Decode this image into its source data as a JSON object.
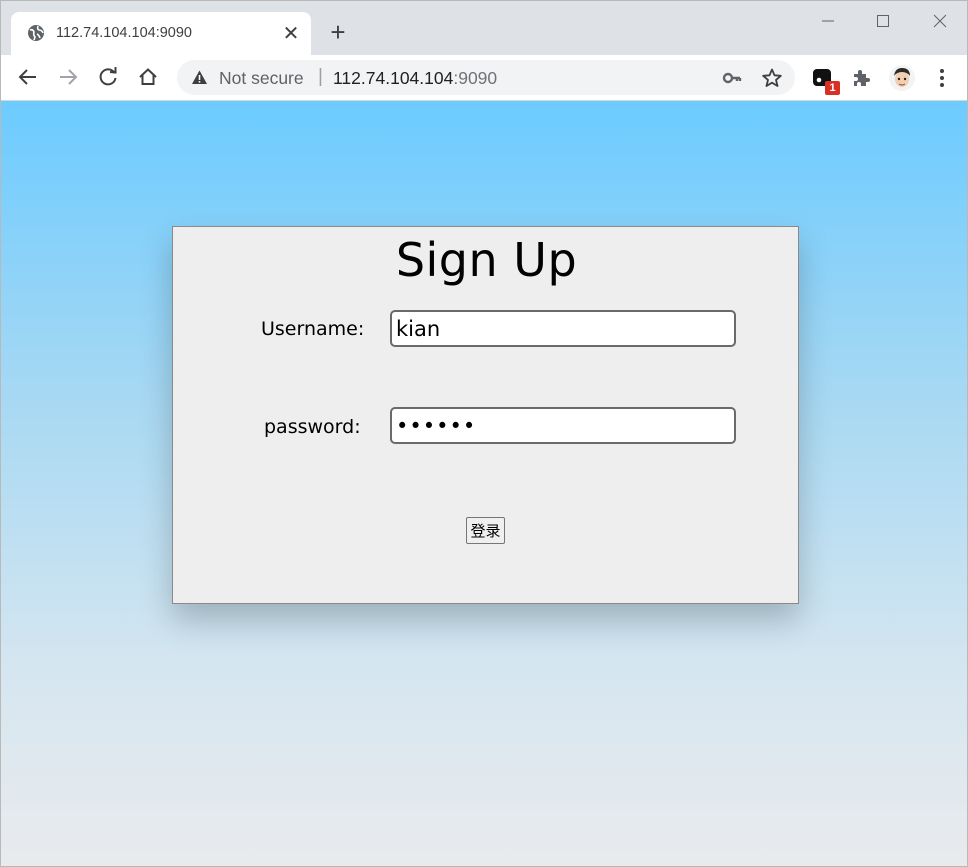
{
  "browser": {
    "tab_title": "112.74.104.104:9090",
    "new_tab_symbol": "+",
    "tab_close_symbol": "✕",
    "address": {
      "security_label": "Not secure",
      "separator": "|",
      "host": "112.74.104.104",
      "port": ":9090"
    },
    "extension_badge": "1",
    "icons": [
      "globe-icon",
      "close-icon",
      "plus-icon",
      "minimize-icon",
      "maximize-icon",
      "window-close-icon",
      "back-icon",
      "forward-icon",
      "reload-icon",
      "home-icon",
      "warning-icon",
      "key-icon",
      "star-icon",
      "extension-icon",
      "puzzle-icon",
      "avatar",
      "menu-dots-icon"
    ]
  },
  "form": {
    "title": "Sign Up",
    "username_label": "Username:",
    "username_value": "kian",
    "password_label": "password:",
    "password_value": "••••••",
    "submit_label": "登录"
  },
  "colors": {
    "page_top": "#6ccbff",
    "page_bottom": "#e9ebed",
    "card_bg": "#eeeeee"
  }
}
